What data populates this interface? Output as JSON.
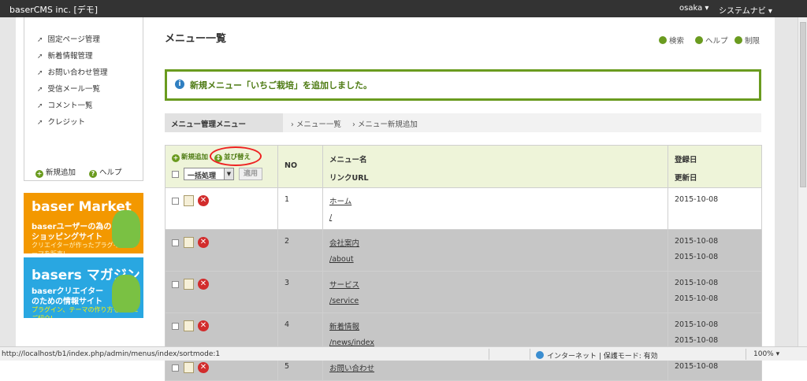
{
  "topbar": {
    "brand": "baserCMS inc. [デモ]",
    "user": "osaka ▾",
    "sysnav": "システムナビ ▾"
  },
  "sidebar": {
    "items": [
      {
        "label": "固定ページ管理"
      },
      {
        "label": "新着情報管理"
      },
      {
        "label": "お問い合わせ管理"
      },
      {
        "label": "受信メール一覧"
      },
      {
        "label": "コメント一覧"
      },
      {
        "label": "クレジット"
      }
    ],
    "add_label": "新規追加",
    "help_label": "ヘルプ"
  },
  "banners": {
    "market": {
      "logo": "baser Market",
      "line1": "baserユーザーの為の",
      "line2": "ショッピングサイト",
      "line3": "クリエイターが作ったプラグイン、テーマを販売!"
    },
    "magazine": {
      "logo": "basers マガジン",
      "line1": "baserクリエイター",
      "line2": "のための情報サイト",
      "line3": "プラグイン、テーマの作り方を丁寧にご紹介!"
    }
  },
  "main": {
    "title": "メニュー一覧",
    "links": {
      "search": "検索",
      "help": "ヘルプ",
      "limit": "制限"
    },
    "notice": "新規メニュー「いちご栽培」を追加しました。",
    "menu_bar": {
      "title": "メニュー管理メニュー",
      "crumb1": "メニュー一覧",
      "crumb2": "メニュー新規追加"
    }
  },
  "table": {
    "add_label": "新規追加",
    "sort_label": "並び替え",
    "bulk_label": "一括処理",
    "apply_label": "適用",
    "col_no": "NO",
    "col_name": "メニュー名",
    "col_url": "リンクURL",
    "col_created": "登録日",
    "col_modified": "更新日",
    "rows": [
      {
        "no": "1",
        "name": "ホーム",
        "url": "/",
        "created": "2015-10-08",
        "modified": ""
      },
      {
        "no": "2",
        "name": "会社案内",
        "url": "/about",
        "created": "2015-10-08",
        "modified": "2015-10-08"
      },
      {
        "no": "3",
        "name": "サービス",
        "url": "/service",
        "created": "2015-10-08",
        "modified": "2015-10-08"
      },
      {
        "no": "4",
        "name": "新着情報",
        "url": "/news/index",
        "created": "2015-10-08",
        "modified": "2015-10-08"
      },
      {
        "no": "5",
        "name": "お問い合わせ",
        "url": "",
        "created": "2015-10-08",
        "modified": ""
      }
    ]
  },
  "statusbar": {
    "url": "http://localhost/b1/index.php/admin/menus/index/sortmode:1",
    "zone": "インターネット | 保護モード: 有効",
    "zoom": "100% ▾"
  }
}
